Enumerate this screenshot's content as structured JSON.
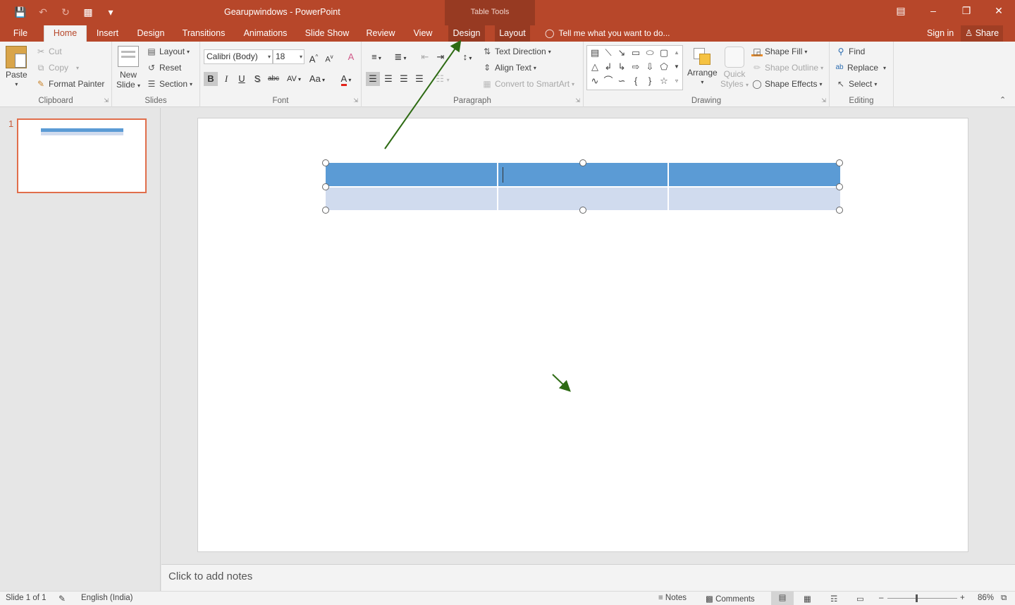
{
  "app": {
    "title": "Gearupwindows - PowerPoint",
    "context_tab_group": "Table Tools"
  },
  "tabs": [
    "File",
    "Home",
    "Insert",
    "Design",
    "Transitions",
    "Animations",
    "Slide Show",
    "Review",
    "View",
    "Design",
    "Layout"
  ],
  "tell_me": "Tell me what you want to do...",
  "sign_in": "Sign in",
  "share": "Share",
  "clipboard": {
    "paste": "Paste",
    "cut": "Cut",
    "copy": "Copy",
    "format_painter": "Format Painter",
    "label": "Clipboard"
  },
  "slides": {
    "new_slide_1": "New",
    "new_slide_2": "Slide",
    "layout": "Layout",
    "reset": "Reset",
    "section": "Section",
    "label": "Slides"
  },
  "font": {
    "name": "Calibri (Body)",
    "size": "18",
    "bold": "B",
    "italic": "I",
    "underline": "U",
    "shadow": "S",
    "strike": "abc",
    "spacing": "AV",
    "case": "Aa",
    "grow": "A",
    "shrink": "A",
    "clear": "A",
    "color": "A",
    "label": "Font"
  },
  "paragraph": {
    "text_direction": "Text Direction",
    "align_text": "Align Text",
    "convert_smartart": "Convert to SmartArt",
    "label": "Paragraph"
  },
  "drawing": {
    "arrange": "Arrange",
    "quick_styles_1": "Quick",
    "quick_styles_2": "Styles",
    "shape_fill": "Shape Fill",
    "shape_outline": "Shape Outline",
    "shape_effects": "Shape Effects",
    "label": "Drawing"
  },
  "editing": {
    "find": "Find",
    "replace": "Replace",
    "select": "Select",
    "label": "Editing"
  },
  "thumbnail": {
    "number": "1"
  },
  "notes_placeholder": "Click to add notes",
  "status": {
    "slide": "Slide 1 of 1",
    "language": "English (India)",
    "notes": "Notes",
    "comments": "Comments",
    "zoom": "86%"
  },
  "colors": {
    "accent": "#b7472a",
    "context": "#973a22",
    "table_header": "#5b9bd5",
    "table_row": "#d0dbee",
    "arrow": "#2e6b14"
  }
}
